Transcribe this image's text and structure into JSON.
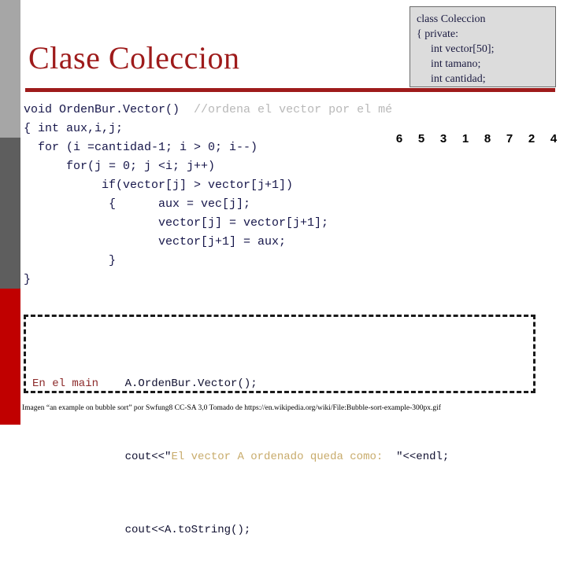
{
  "slide": {
    "title": "Clase Coleccion",
    "accent_color": "#9e1b1b",
    "sidebar": {
      "bands": [
        {
          "name": "band-light-gray",
          "color": "#a6a6a6"
        },
        {
          "name": "band-dark-gray",
          "color": "#5e5e5e"
        },
        {
          "name": "band-red",
          "color": "#c00000"
        }
      ]
    }
  },
  "class_box": {
    "lines": [
      "class Coleccion",
      "{ private:",
      "int vector[50];",
      "int tamano;",
      "int cantidad;"
    ]
  },
  "code": {
    "line1_code": "void OrdenBur.Vector()  ",
    "line1_comment": "//ordena el vector por el mé",
    "lines": [
      "{ int aux,i,j;",
      "  for (i =cantidad-1; i > 0; i--)",
      "      for(j = 0; j <i; j++)",
      "           if(vector[j] > vector[j+1])",
      "            {      aux = vec[j];",
      "                   vector[j] = vector[j+1];",
      "                   vector[j+1] = aux;",
      "            }",
      "}"
    ]
  },
  "numbers": {
    "label": "bubble-sort-example-values",
    "values": [
      6,
      5,
      3,
      1,
      8,
      7,
      2,
      4
    ]
  },
  "main_box": {
    "label": "En el main",
    "call_line": "A.OrdenBur.Vector();",
    "cout_prefix": "cout<<\"",
    "cout_string": "El vector A ordenado queda como:  ",
    "cout_suffix": "\"<<endl;",
    "tostring_line": "cout<<A.toString();"
  },
  "caption": {
    "text": "Imagen “an example on bubble sort” por Swfung8 CC-SA 3,0 Tomado de https://en.wikipedia.org/wiki/File:Bubble-sort-example-300px.gif"
  }
}
